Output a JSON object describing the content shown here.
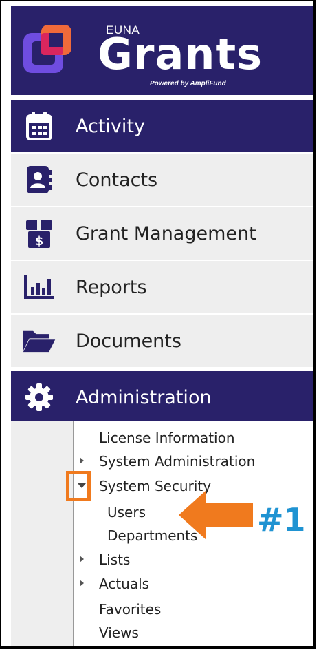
{
  "brand": {
    "company": "EUNA",
    "product": "Grants",
    "tagline": "Powered by AmpliFund"
  },
  "nav": [
    {
      "label": "Activity",
      "icon": "calendar-icon",
      "active": true
    },
    {
      "label": "Contacts",
      "icon": "contact-book-icon",
      "active": false
    },
    {
      "label": "Grant Management",
      "icon": "gift-box-dollar-icon",
      "active": false
    },
    {
      "label": "Reports",
      "icon": "bar-chart-icon",
      "active": false
    },
    {
      "label": "Documents",
      "icon": "folder-open-icon",
      "active": false
    },
    {
      "label": "Administration",
      "icon": "gear-icon",
      "active": true
    }
  ],
  "admin_menu": {
    "items": [
      {
        "label": "License Information",
        "expander": "none"
      },
      {
        "label": "System Administration",
        "expander": "collapsed"
      },
      {
        "label": "System Security",
        "expander": "expanded"
      },
      {
        "label": "Users",
        "expander": "none"
      },
      {
        "label": "Departments",
        "expander": "none"
      },
      {
        "label": "Lists",
        "expander": "collapsed"
      },
      {
        "label": "Actuals",
        "expander": "collapsed"
      },
      {
        "label": "Favorites",
        "expander": "none"
      },
      {
        "label": "Views",
        "expander": "none"
      }
    ]
  },
  "annotation": {
    "label": "#1",
    "highlight_color": "#f07a1e",
    "label_color": "#1f93d2"
  },
  "colors": {
    "nav_dark": "#29216a",
    "nav_light": "#eeeeee"
  }
}
